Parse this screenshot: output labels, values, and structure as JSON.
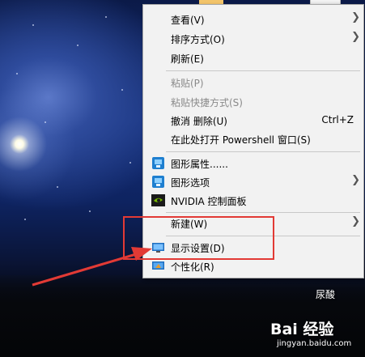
{
  "menu": {
    "items": [
      {
        "label": "查看(V)",
        "has_submenu": true,
        "enabled": true
      },
      {
        "label": "排序方式(O)",
        "has_submenu": true,
        "enabled": true
      },
      {
        "label": "刷新(E)",
        "has_submenu": false,
        "enabled": true
      },
      {
        "label": "粘贴(P)",
        "has_submenu": false,
        "enabled": false
      },
      {
        "label": "粘贴快捷方式(S)",
        "has_submenu": false,
        "enabled": false
      },
      {
        "label": "撤消 删除(U)",
        "shortcut": "Ctrl+Z",
        "has_submenu": false,
        "enabled": true
      },
      {
        "label": "在此处打开 Powershell 窗口(S)",
        "has_submenu": false,
        "enabled": true
      },
      {
        "label": "图形属性......",
        "icon": "intel-graphics-icon",
        "has_submenu": false,
        "enabled": true
      },
      {
        "label": "图形选项",
        "icon": "intel-graphics-icon",
        "has_submenu": true,
        "enabled": true
      },
      {
        "label": "NVIDIA 控制面板",
        "icon": "nvidia-icon",
        "has_submenu": false,
        "enabled": true
      },
      {
        "label": "新建(W)",
        "has_submenu": true,
        "enabled": true
      },
      {
        "label": "显示设置(D)",
        "icon": "display-icon",
        "has_submenu": false,
        "enabled": true,
        "highlighted": true
      },
      {
        "label": "个性化(R)",
        "icon": "personalize-icon",
        "has_submenu": false,
        "enabled": true
      }
    ]
  },
  "desktop": {
    "icon_label": "尿酸"
  },
  "watermark": {
    "brand": "Bai 经验",
    "site": "jingyan.baidu.com"
  },
  "colors": {
    "highlight_box": "#e23a35",
    "menu_bg": "#f2f2f2"
  }
}
